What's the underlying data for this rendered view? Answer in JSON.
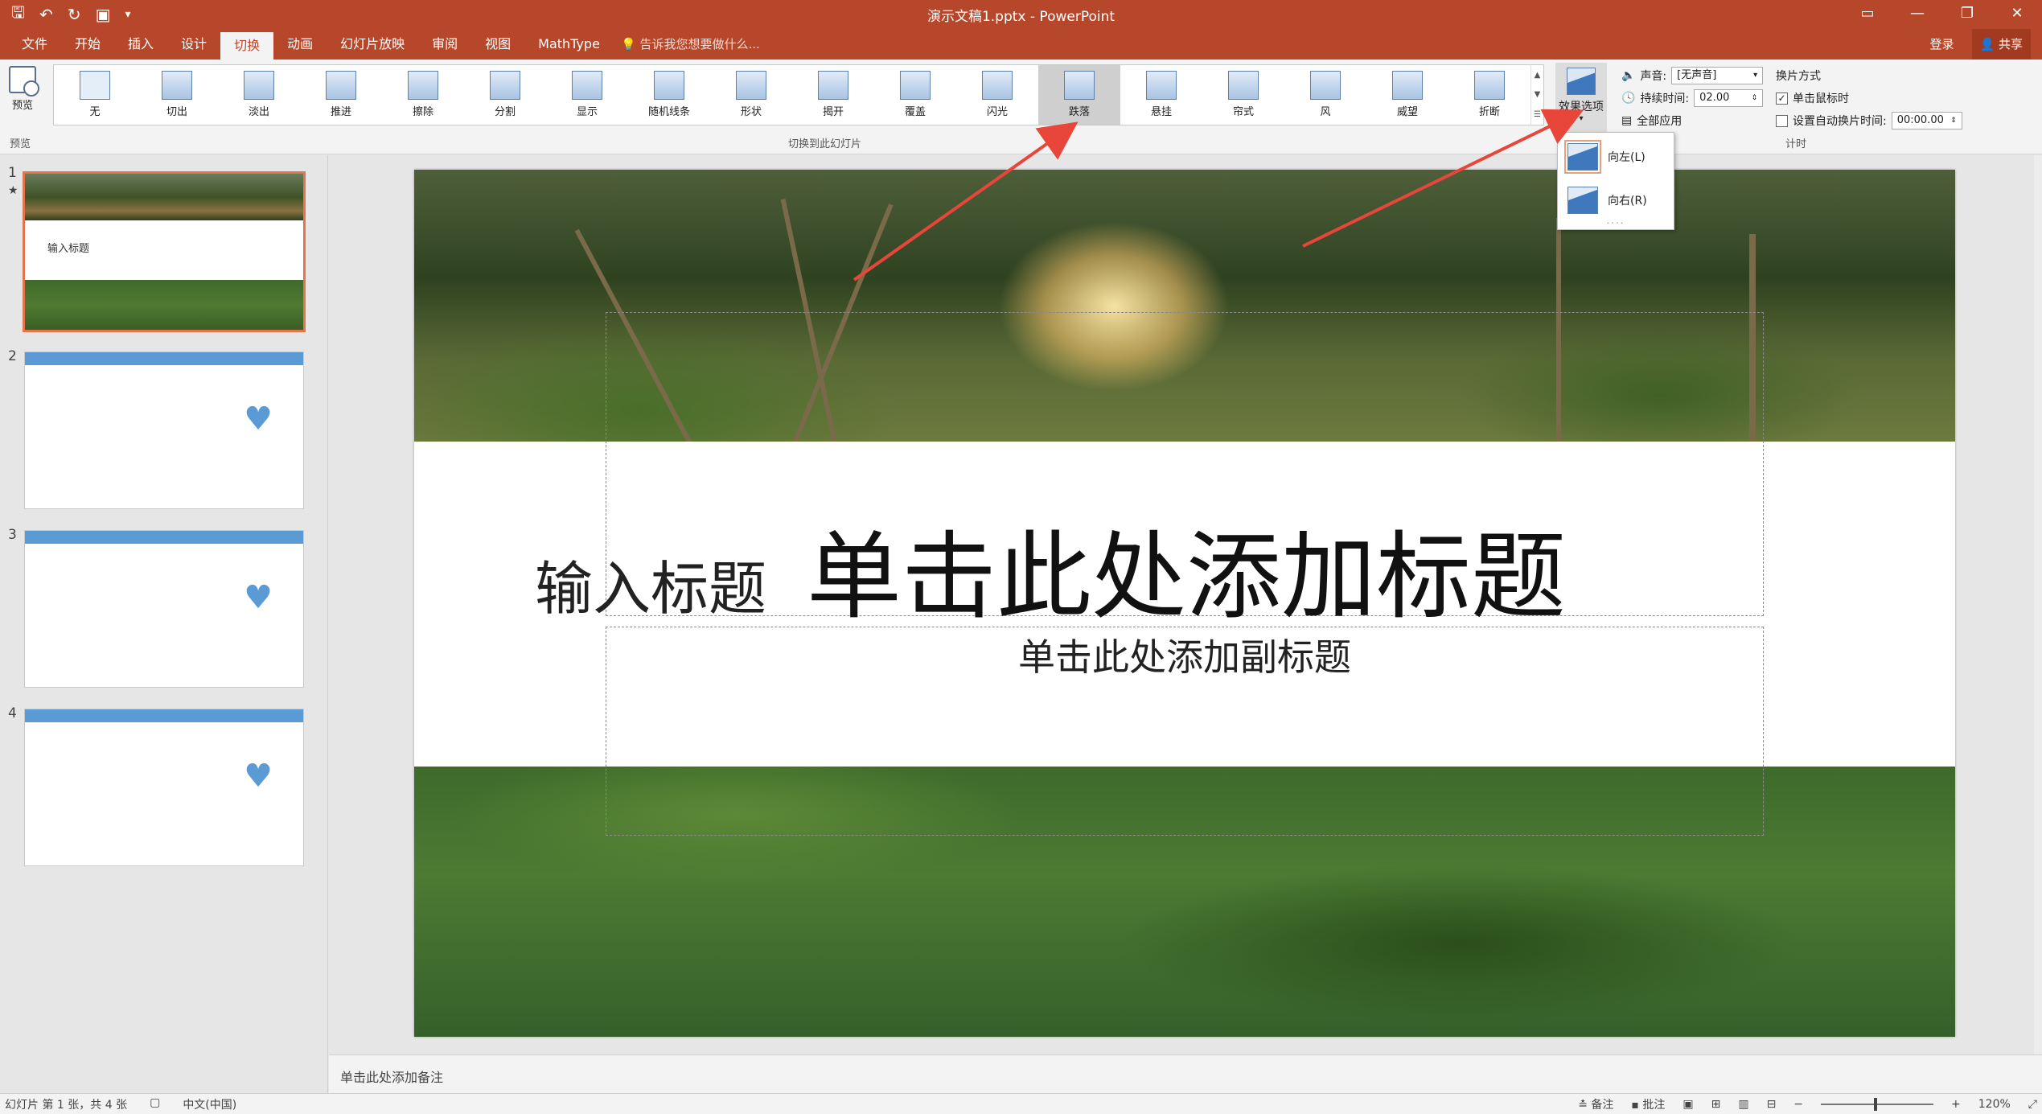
{
  "window": {
    "title": "演示文稿1.pptx - PowerPoint",
    "controls": [
      "ribbon-display",
      "minimize",
      "restore",
      "close"
    ]
  },
  "tabs": [
    {
      "label": "文件"
    },
    {
      "label": "开始"
    },
    {
      "label": "插入"
    },
    {
      "label": "设计"
    },
    {
      "label": "切换",
      "active": true
    },
    {
      "label": "动画"
    },
    {
      "label": "幻灯片放映"
    },
    {
      "label": "审阅"
    },
    {
      "label": "视图"
    },
    {
      "label": "MathType"
    }
  ],
  "tellme": "告诉我您想要做什么...",
  "account": {
    "login": "登录",
    "share": "共享"
  },
  "ribbon": {
    "preview_label": "预览",
    "preview_group": "预览",
    "transitions_group": "切换到此幻灯片",
    "transitions": [
      {
        "label": "无"
      },
      {
        "label": "切出"
      },
      {
        "label": "淡出"
      },
      {
        "label": "推进"
      },
      {
        "label": "擦除"
      },
      {
        "label": "分割"
      },
      {
        "label": "显示"
      },
      {
        "label": "随机线条"
      },
      {
        "label": "形状"
      },
      {
        "label": "揭开"
      },
      {
        "label": "覆盖"
      },
      {
        "label": "闪光"
      },
      {
        "label": "跌落",
        "selected": true
      },
      {
        "label": "悬挂"
      },
      {
        "label": "帘式"
      },
      {
        "label": "风"
      },
      {
        "label": "威望"
      },
      {
        "label": "折断"
      }
    ],
    "effect_options": "效果选项",
    "sound_label": "声音:",
    "sound_value": "[无声音]",
    "duration_label": "持续时间:",
    "duration_value": "02.00",
    "apply_all": "全部应用",
    "advance_title": "换片方式",
    "on_click": "单击鼠标时",
    "after_label": "设置自动换片时间:",
    "after_value": "00:00.00",
    "timing_group": "计时"
  },
  "dropdown": {
    "items": [
      {
        "label": "向左(L)",
        "selected": true
      },
      {
        "label": "向右(R)"
      }
    ],
    "more": "...."
  },
  "slides": [
    {
      "number": "1",
      "text": "输入标题",
      "active": true
    },
    {
      "number": "2"
    },
    {
      "number": "3"
    },
    {
      "number": "4"
    }
  ],
  "slide_content": {
    "title_small": "输入标题",
    "title_big": "单击此处添加标题",
    "subtitle": "单击此处添加副标题"
  },
  "notes_placeholder": "单击此处添加备注",
  "status": {
    "slide_info": "幻灯片 第 1 张，共 4 张",
    "language": "中文(中国)",
    "notes": "备注",
    "comments": "批注",
    "zoom": "120%"
  },
  "colors": {
    "accent": "#b7472a",
    "thumb_bar": "#5b9bd5",
    "annotation_arrow": "#e8463a"
  }
}
